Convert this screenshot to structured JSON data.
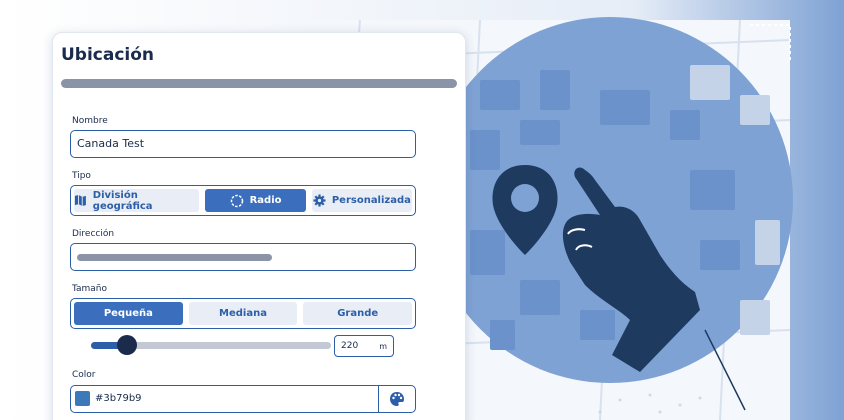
{
  "panel": {
    "title": "Ubicación"
  },
  "form": {
    "name": {
      "label": "Nombre",
      "value": "Canada Test"
    },
    "type": {
      "label": "Tipo",
      "options": [
        "División geográfica",
        "Radio",
        "Personalizada"
      ],
      "selected": "Radio"
    },
    "address": {
      "label": "Dirección"
    },
    "size": {
      "label": "Tamaño",
      "options": [
        "Pequeña",
        "Mediana",
        "Grande"
      ],
      "selected": "Pequeña",
      "slider_fraction": 0.15,
      "value": "220",
      "unit": "m"
    },
    "color": {
      "label": "Color",
      "value": "#3b79b9"
    }
  },
  "colors": {
    "accent": "#2d5ea8",
    "selected_button": "#3b6fbe",
    "map_circle": "#7fa2d4",
    "hand": "#1e3a5f"
  },
  "icons": {
    "map": "map-icon",
    "radio": "radius-circle-icon",
    "custom": "gear-icon",
    "palette": "palette-icon",
    "pin": "location-pin-icon",
    "hand": "pointing-hand-icon"
  }
}
